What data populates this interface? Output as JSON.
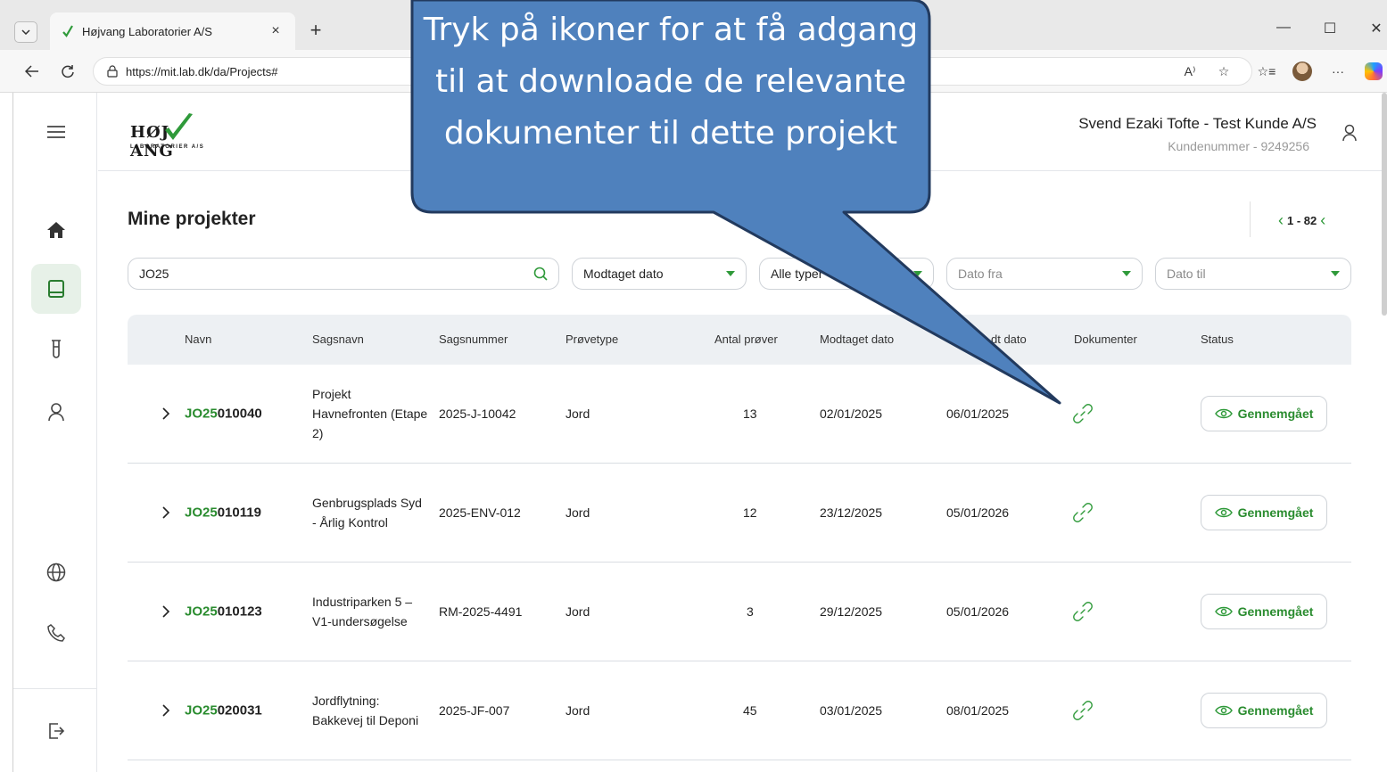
{
  "browser": {
    "tab_title": "Højvang Laboratorier A/S",
    "url": "https://mit.lab.dk/da/Projects#",
    "new_tab_glyph": "+",
    "tab_close_glyph": "×",
    "read_aloud_glyph": "A⁾"
  },
  "callout": {
    "text": "Tryk på ikoner for at få adgang til at downloade de relevante dokumenter til dette projekt",
    "color": "#4f81bd"
  },
  "brand": {
    "logo_left": "HØJ",
    "logo_right": "ANG",
    "logo_sub": "LABORATORIER A/S",
    "accent": "#2f9a3a"
  },
  "header": {
    "user_name": "Svend Ezaki Tofte - Test Kunde A/S",
    "customer_number": "Kundenummer - 9249256"
  },
  "page": {
    "title": "Mine projekter",
    "pager": "1 - 82"
  },
  "filters": {
    "search_value": "JO25",
    "date_type": "Modtaget dato",
    "type": "Alle typer",
    "date_from": "Dato fra",
    "date_to": "Dato til"
  },
  "table": {
    "headers": {
      "navn": "Navn",
      "sagsnavn": "Sagsnavn",
      "sagsnummer": "Sagsnummer",
      "provetype": "Prøvetype",
      "antal": "Antal prøver",
      "modtaget": "Modtaget dato",
      "afsluttet": "dt dato",
      "dokumenter": "Dokumenter",
      "status": "Status"
    },
    "rows": [
      {
        "id_prefix": "JO25",
        "id_rest": "010040",
        "sagsnavn": "Projekt Havnefronten (Etape 2)",
        "sagsnummer": "2025-J-10042",
        "provetype": "Jord",
        "antal": "13",
        "modtaget": "02/01/2025",
        "afsluttet": "06/01/2025",
        "status": "Gennemgået"
      },
      {
        "id_prefix": "JO25",
        "id_rest": "010119",
        "sagsnavn": "Genbrugsplads Syd - Årlig Kontrol",
        "sagsnummer": "2025-ENV-012",
        "provetype": "Jord",
        "antal": "12",
        "modtaget": "23/12/2025",
        "afsluttet": "05/01/2026",
        "status": "Gennemgået"
      },
      {
        "id_prefix": "JO25",
        "id_rest": "010123",
        "sagsnavn": "Industriparken 5 – V1-undersøgelse",
        "sagsnummer": "RM-2025-4491",
        "provetype": "Jord",
        "antal": "3",
        "modtaget": "29/12/2025",
        "afsluttet": "05/01/2026",
        "status": "Gennemgået"
      },
      {
        "id_prefix": "JO25",
        "id_rest": "020031",
        "sagsnavn": "Jordflytning: Bakkevej til Deponi",
        "sagsnummer": "2025-JF-007",
        "provetype": "Jord",
        "antal": "45",
        "modtaget": "03/01/2025",
        "afsluttet": "08/01/2025",
        "status": "Gennemgået"
      }
    ]
  },
  "icons": [
    "menu-icon",
    "home-icon",
    "projects-icon",
    "test-tube-icon",
    "user-icon",
    "globe-icon",
    "phone-icon",
    "logout-icon",
    "link-icon",
    "eye-icon",
    "search-icon",
    "chevron-right-icon"
  ]
}
